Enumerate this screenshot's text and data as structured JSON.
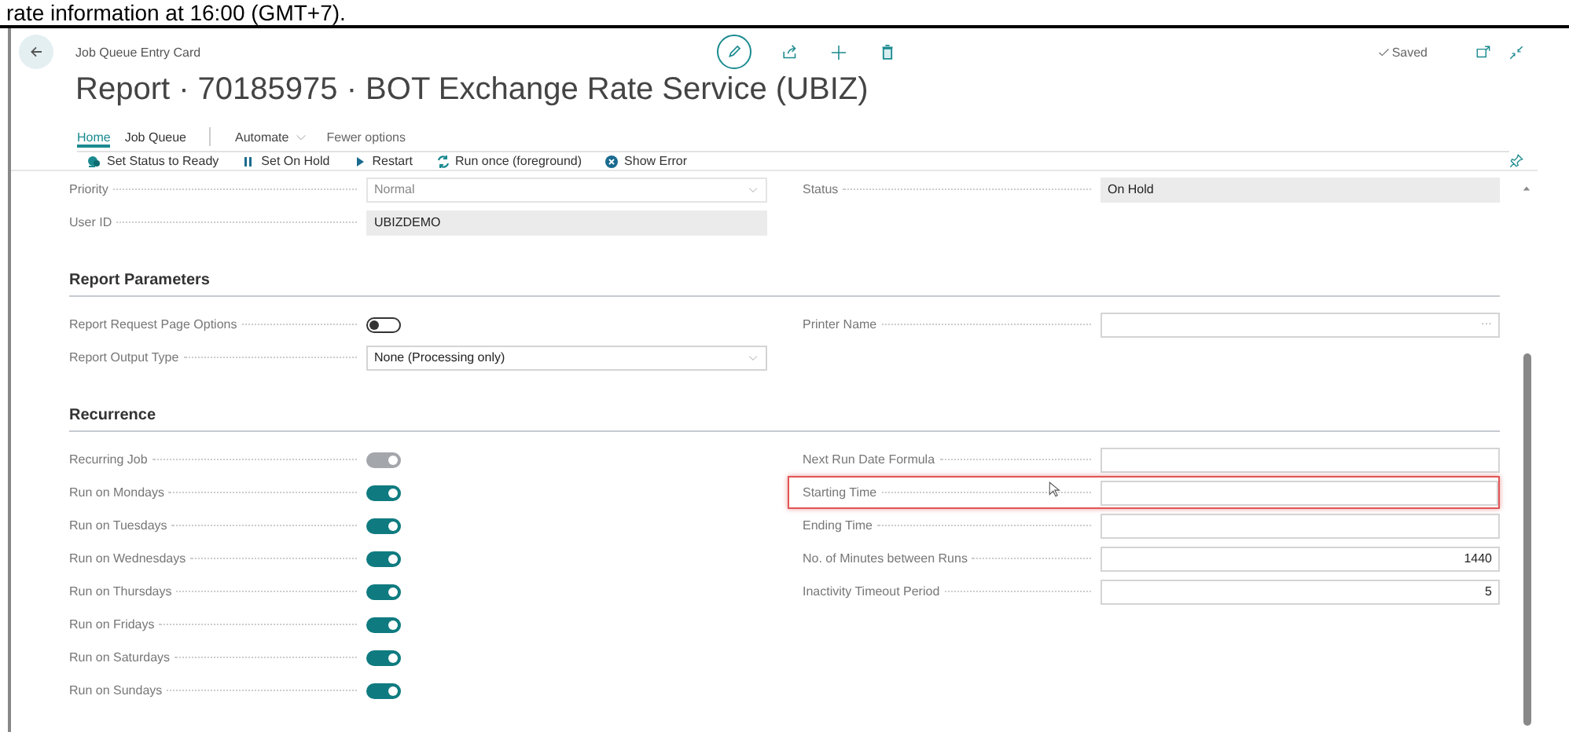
{
  "caption": "rate information at 16:00 (GMT+7).",
  "header": {
    "breadcrumb": "Job Queue Entry Card",
    "title": "Report · 70185975 · BOT Exchange Rate Service (UBIZ)",
    "status": "Saved"
  },
  "nav": {
    "tabs": [
      {
        "label": "Home",
        "selected": true
      },
      {
        "label": "Job Queue",
        "selected": false
      }
    ],
    "menus": [
      {
        "label": "Automate",
        "kind": "menu"
      },
      {
        "label": "Fewer options",
        "kind": "link"
      }
    ]
  },
  "actions": [
    {
      "label": "Set Status to Ready",
      "kind": "ready"
    },
    {
      "label": "Set On Hold",
      "kind": "pause"
    },
    {
      "label": "Restart",
      "kind": "play"
    },
    {
      "label": "Run once (foreground)",
      "kind": "run"
    },
    {
      "label": "Show Error",
      "kind": "error"
    }
  ],
  "sections": [
    {
      "left": [
        {
          "label": "Priority",
          "kind": "dropdown",
          "value": "Normal",
          "disabled": true
        },
        {
          "label": "User ID",
          "kind": "readonly",
          "value": "UBIZDEMO"
        }
      ],
      "right": [
        {
          "label": "Status",
          "kind": "readonly",
          "value": "On Hold"
        }
      ]
    },
    {
      "heading": "Report Parameters",
      "left": [
        {
          "label": "Report Request Page Options",
          "kind": "toggle",
          "on": false,
          "disabled": false
        },
        {
          "label": "Report Output Type",
          "kind": "dropdown",
          "value": "None (Processing only)",
          "disabled": false
        }
      ],
      "right": [
        {
          "label": "Printer Name",
          "kind": "lookup",
          "button": "···"
        }
      ]
    },
    {
      "heading": "Recurrence",
      "left": [
        {
          "label": "Recurring Job",
          "kind": "toggle",
          "on": true,
          "disabled": true
        },
        {
          "label": "Run on Mondays",
          "kind": "toggle",
          "on": true,
          "disabled": false
        },
        {
          "label": "Run on Tuesdays",
          "kind": "toggle",
          "on": true,
          "disabled": false
        },
        {
          "label": "Run on Wednesdays",
          "kind": "toggle",
          "on": true,
          "disabled": false
        },
        {
          "label": "Run on Thursdays",
          "kind": "toggle",
          "on": true,
          "disabled": false
        },
        {
          "label": "Run on Fridays",
          "kind": "toggle",
          "on": true,
          "disabled": false
        },
        {
          "label": "Run on Saturdays",
          "kind": "toggle",
          "on": true,
          "disabled": false
        },
        {
          "label": "Run on Sundays",
          "kind": "toggle",
          "on": true,
          "disabled": false
        }
      ],
      "right": [
        {
          "label": "Next Run Date Formula",
          "kind": "text",
          "highlighted": false
        },
        {
          "label": "Starting Time",
          "kind": "text",
          "highlighted": true
        },
        {
          "label": "Ending Time",
          "kind": "text",
          "highlighted": false
        },
        {
          "label": "No. of Minutes between Runs",
          "kind": "number",
          "value": "1440",
          "highlighted": false
        },
        {
          "label": "Inactivity Timeout Period",
          "kind": "number",
          "value": "5",
          "highlighted": false
        }
      ]
    }
  ]
}
